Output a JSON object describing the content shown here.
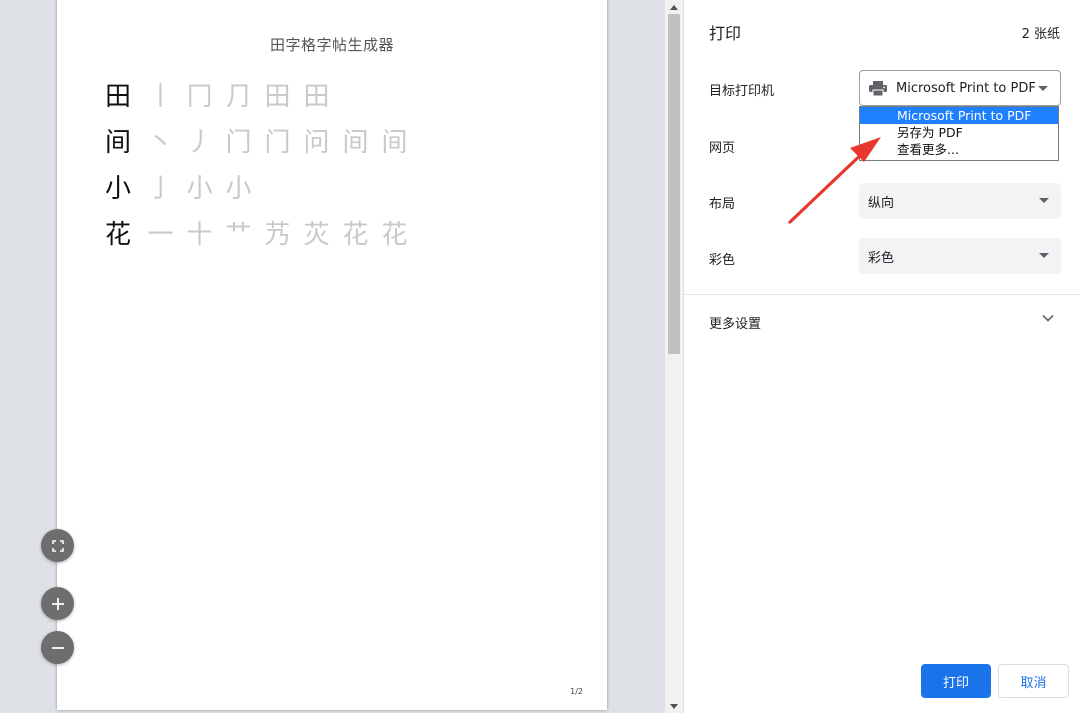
{
  "preview": {
    "doc_title": "田字格字帖生成器",
    "rows": [
      {
        "char": "田",
        "strokes": [
          "丨",
          "冂",
          "⺆",
          "田",
          "田"
        ]
      },
      {
        "char": "间",
        "strokes": [
          "丶",
          "丿",
          "门",
          "门",
          "问",
          "间",
          "间"
        ]
      },
      {
        "char": "小",
        "strokes": [
          "亅",
          "小",
          "小"
        ]
      },
      {
        "char": "花",
        "strokes": [
          "一",
          "十",
          "艹",
          "艿",
          "苂",
          "花",
          "花"
        ]
      }
    ],
    "page_number": "1/2",
    "zoom_buttons": [
      {
        "name": "fit-to-page-button",
        "icon": "fit-page-icon"
      },
      {
        "name": "zoom-in-button",
        "icon": "plus-icon"
      },
      {
        "name": "zoom-out-button",
        "icon": "minus-icon"
      }
    ]
  },
  "sidebar": {
    "title": "打印",
    "sheets": "2 张纸",
    "destination_label": "目标打印机",
    "destination_value": "Microsoft Print to PDF",
    "destination_options": [
      "Microsoft Print to PDF",
      "另存为 PDF",
      "查看更多..."
    ],
    "pages_label": "网页",
    "layout_label": "布局",
    "layout_value": "纵向",
    "color_label": "彩色",
    "color_value": "彩色",
    "more_settings_label": "更多设置",
    "print_button": "打印",
    "cancel_button": "取消"
  },
  "colors": {
    "accent": "#1a73e8",
    "dropdown_highlight": "#1e80ff",
    "annotation": "#e8372c"
  }
}
